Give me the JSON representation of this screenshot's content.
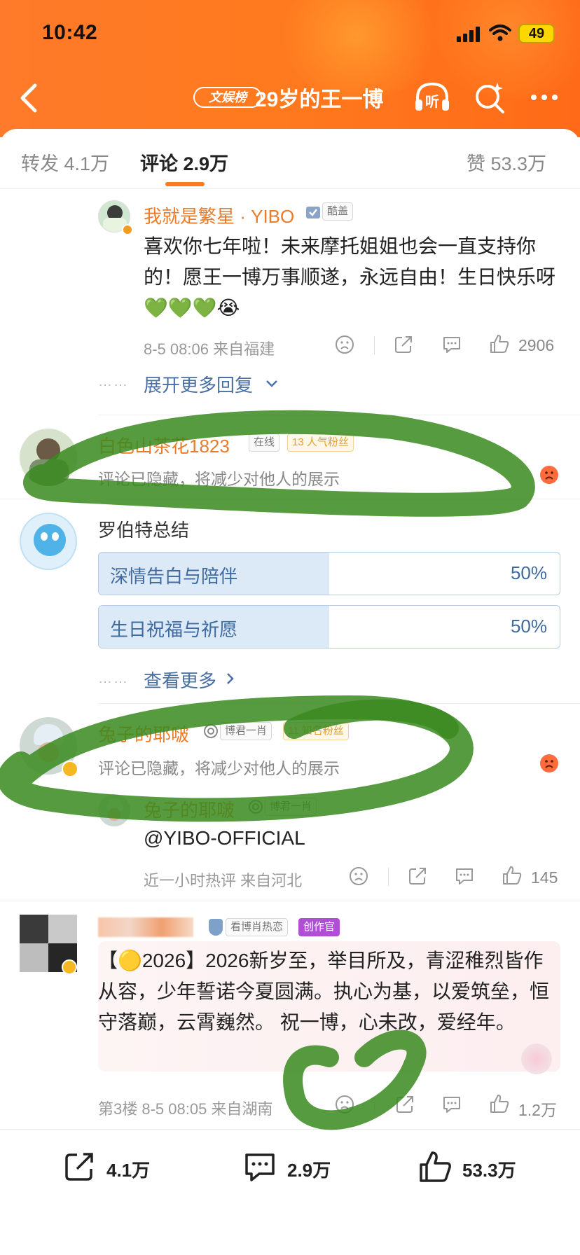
{
  "status_bar": {
    "time": "10:42",
    "battery": "49"
  },
  "header": {
    "tag": "文娱榜",
    "title": "29岁的王一博"
  },
  "tabs": {
    "repost": "转发 4.1万",
    "comment": "评论 2.9万",
    "like": "赞 53.3万"
  },
  "comments": [
    {
      "name": "我就是繁星 · YIBO",
      "badge": "酷盖",
      "text": "喜欢你七年啦！未来摩托姐姐也会一直支持你的！愿王一博万事顺遂，永远自由！生日快乐呀💚💚💚😭",
      "meta": "8-5 08:06  来自福建",
      "likes": "2906",
      "more_replies": "展开更多回复"
    },
    {
      "name": "白色山茶花1823",
      "badge1": "在线",
      "badge2": "13 人气粉丝",
      "hidden": "评论已隐藏，将减少对他人的展示"
    },
    {
      "name": "罗伯特总结",
      "poll": [
        {
          "label": "深情告白与陪伴",
          "pct": "50%",
          "fraction": 0.5
        },
        {
          "label": "生日祝福与祈愿",
          "pct": "50%",
          "fraction": 0.5
        }
      ],
      "see_more": "查看更多"
    },
    {
      "name": "兔子的耶啵",
      "badge1": "博君一肖",
      "badge2": "11 知名粉丝",
      "hidden": "评论已隐藏，将减少对他人的展示",
      "reply_name": "兔子的耶啵",
      "reply_badge": "博君一肖",
      "reply_text": "@YIBO-OFFICIAL",
      "meta": "近一小时热评  来自河北",
      "likes": "145"
    },
    {
      "badge1": "看博肖热恋",
      "badge2": "创作官",
      "text": "【🟡2026】2026新岁至，举目所及，青涩稚烈皆作从容，少年誓诺今夏圆满。执心为基，以爱筑垒，恒守落巅，云霄巍然。 祝一博，心未改，爱经年。",
      "meta": "第3楼  8-5 08:05  来自湖南",
      "likes": "1.2万"
    }
  ],
  "bottom_bar": {
    "repost": "4.1万",
    "comment": "2.9万",
    "like": "53.3万"
  },
  "colors": {
    "brand": "#ff7a1e",
    "name": "#ea7b2a",
    "link": "#4a6fa5",
    "poll": "#dceaf8",
    "marker": "#3a8a1e"
  }
}
